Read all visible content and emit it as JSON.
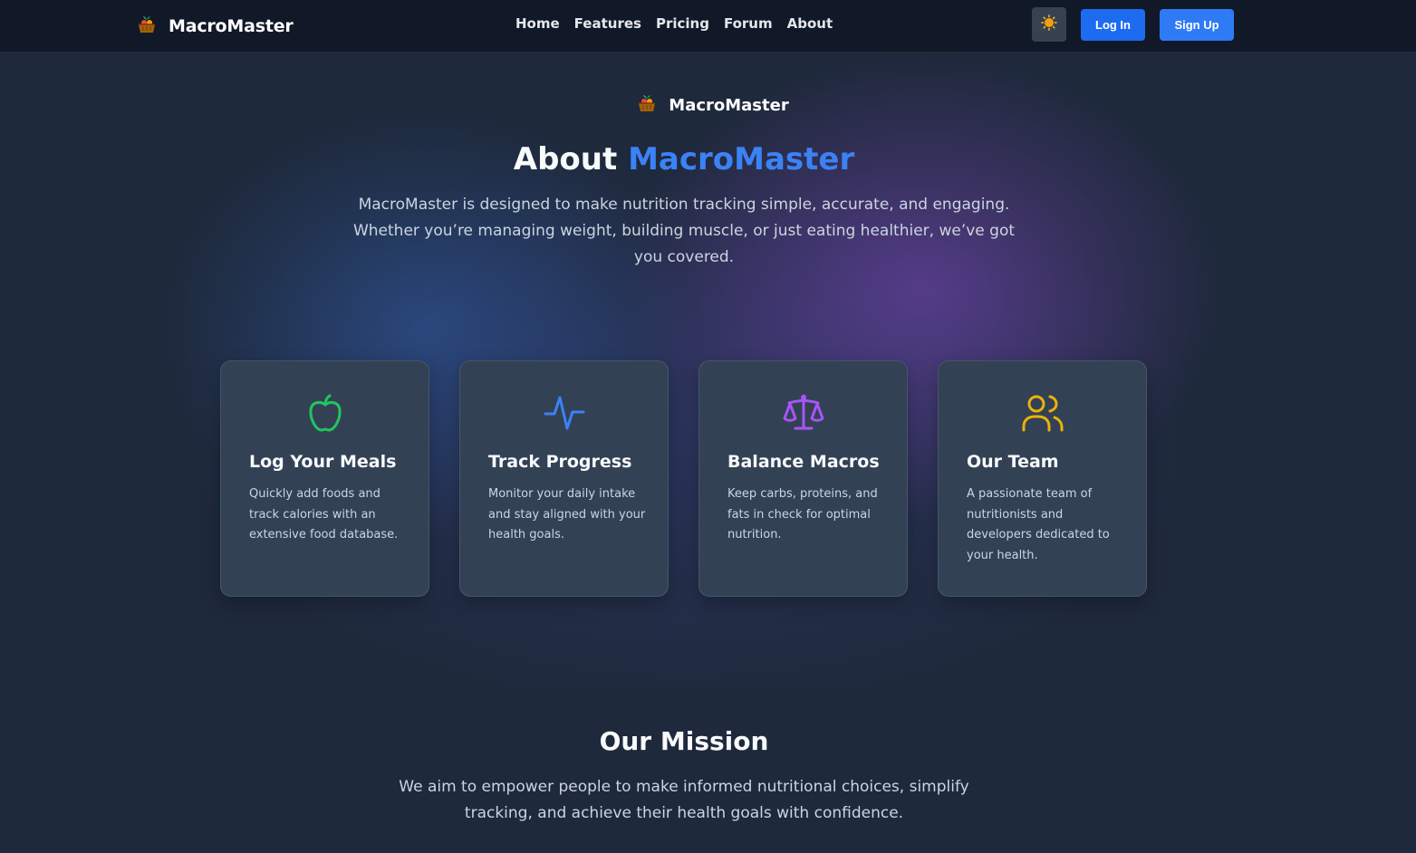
{
  "nav": {
    "brand": "MacroMaster",
    "brand_icon": "basket-icon",
    "links": [
      "Home",
      "Features",
      "Pricing",
      "Forum",
      "About"
    ],
    "theme_icon": "sun-icon",
    "login_label": "Log In",
    "signup_label": "Sign Up"
  },
  "hero": {
    "brand": "MacroMaster",
    "title_prefix": "About",
    "title_accent": "MacroMaster",
    "description": "MacroMaster is designed to make nutrition tracking simple, accurate, and engaging. Whether you’re managing weight, building muscle, or just eating healthier, we’ve got you covered."
  },
  "cards": [
    {
      "icon": "apple-icon",
      "title": "Log Your Meals",
      "text": "Quickly add foods and track calories with an extensive food database.",
      "color": "#22c55e"
    },
    {
      "icon": "activity-icon",
      "title": "Track Progress",
      "text": "Monitor your daily intake and stay aligned with your health goals.",
      "color": "#3b82f6"
    },
    {
      "icon": "scale-icon",
      "title": "Balance Macros",
      "text": "Keep carbs, proteins, and fats in check for optimal nutrition.",
      "color": "#a855f7"
    },
    {
      "icon": "users-icon",
      "title": "Our Team",
      "text": "A passionate team of nutritionists and developers dedicated to your health.",
      "color": "#eab308"
    }
  ],
  "mission": {
    "title": "Our Mission",
    "text": "We aim to empower people to make informed nutritional choices, simplify tracking, and achieve their health goals with confidence."
  },
  "colors": {
    "accent": "#3b82f6",
    "background": "#1e293b",
    "navbar": "#111827",
    "card": "#334155"
  }
}
